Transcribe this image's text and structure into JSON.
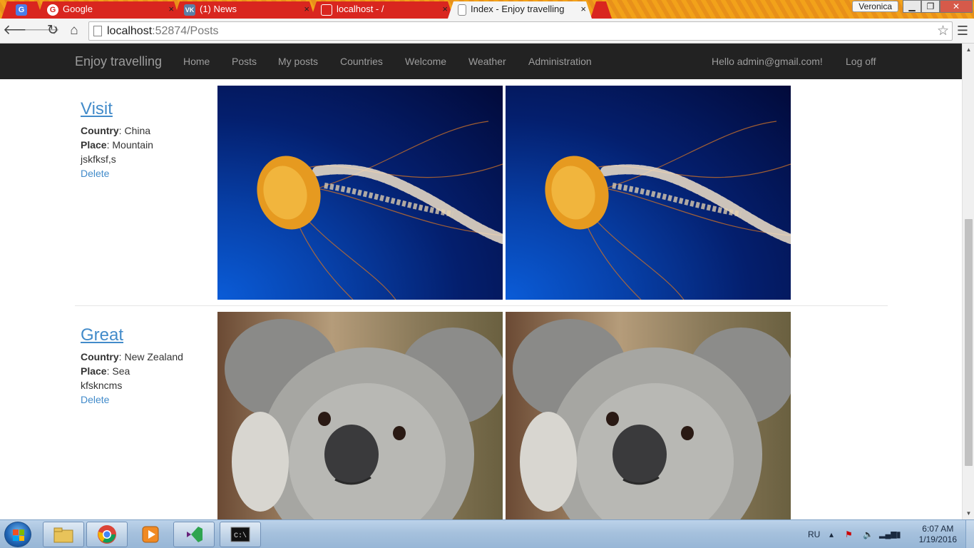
{
  "browser": {
    "tabs": [
      {
        "label": "",
        "icon": "google-translate-icon",
        "active": false
      },
      {
        "label": "Google",
        "icon": "google-icon",
        "active": false
      },
      {
        "label": "(1) News",
        "icon": "vk-icon",
        "active": false
      },
      {
        "label": "localhost - /",
        "icon": "page-icon",
        "active": false
      },
      {
        "label": "Index - Enjoy travelling",
        "icon": "page-icon",
        "active": true
      }
    ],
    "close_glyph": "×",
    "profile_name": "Veronica",
    "url_host": "localhost",
    "url_path": ":52874/Posts"
  },
  "nav": {
    "brand": "Enjoy travelling",
    "links": [
      "Home",
      "Posts",
      "My posts",
      "Countries",
      "Welcome",
      "Weather",
      "Administration"
    ],
    "greeting": "Hello admin@gmail.com!",
    "logoff": "Log off"
  },
  "labels": {
    "country": "Country",
    "place": "Place",
    "delete": "Delete"
  },
  "posts": [
    {
      "title": "Visit",
      "country": "China",
      "place": "Mountain",
      "description": "jskfksf,s",
      "images": [
        "jellyfish-photo",
        "jellyfish-photo"
      ]
    },
    {
      "title": "Great",
      "country": "New Zealand",
      "place": "Sea",
      "description": "kfskncms",
      "images": [
        "koala-photo",
        "koala-photo"
      ]
    }
  ],
  "taskbar": {
    "language": "RU",
    "time": "6:07 AM",
    "date": "1/19/2016",
    "apps": [
      "file-explorer-icon",
      "chrome-icon",
      "media-player-icon",
      "visual-studio-icon",
      "command-prompt-icon"
    ]
  },
  "colors": {
    "navbar_bg": "#222222",
    "nav_text": "#9d9d9d",
    "link": "#428bca",
    "tab_bg": "#d9261f"
  }
}
